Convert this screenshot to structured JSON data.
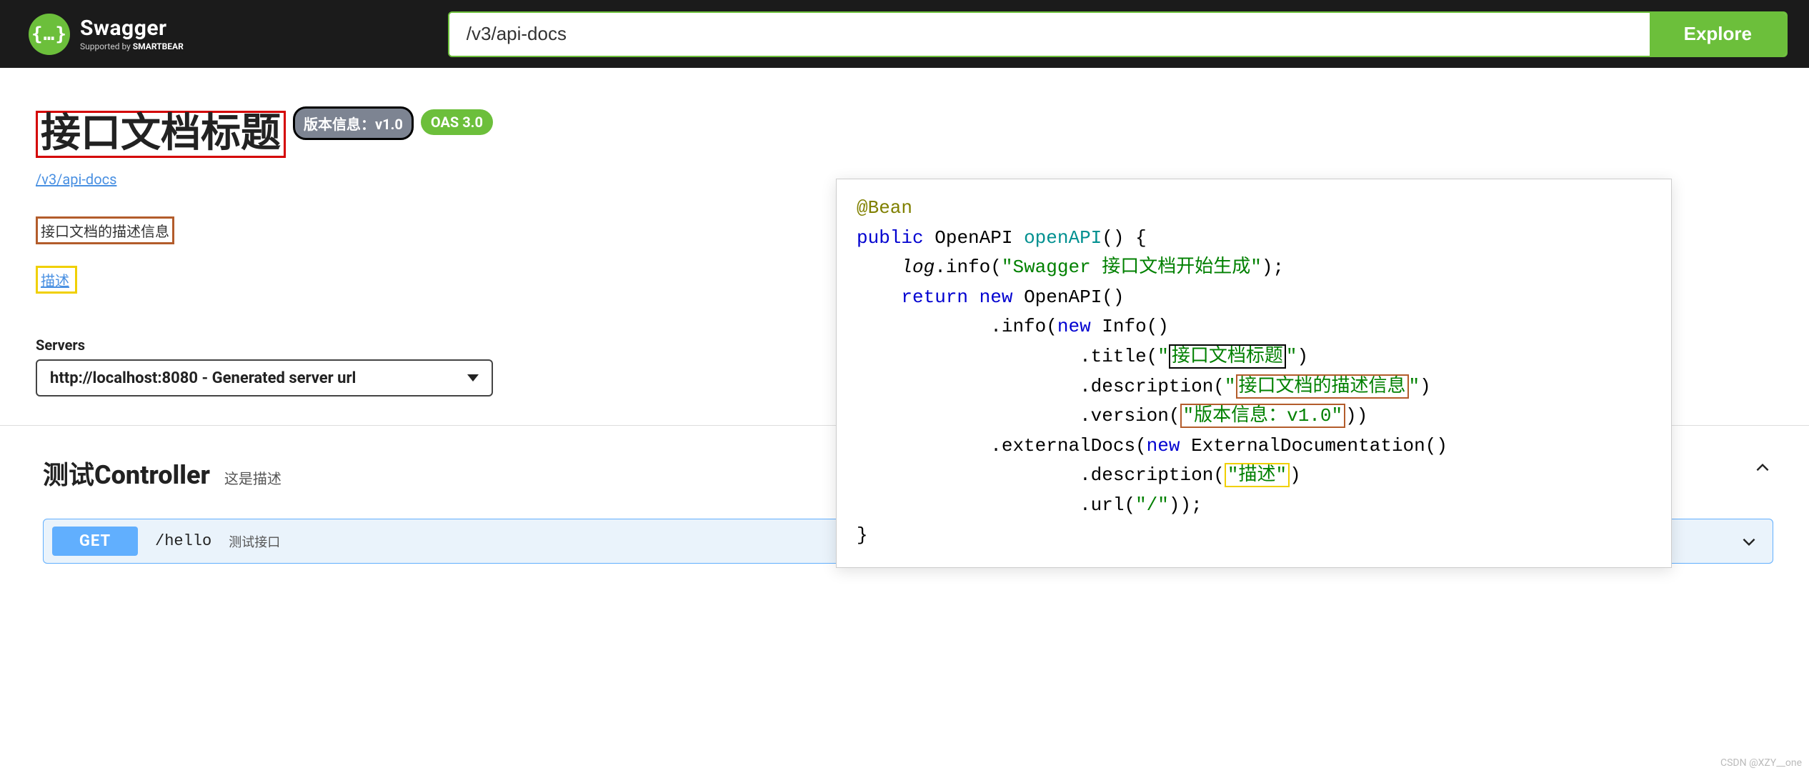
{
  "topbar": {
    "brand": "Swagger",
    "brand_sub_prefix": "Supported by ",
    "brand_sub_bold": "SMARTBEAR",
    "logo_glyph": "{…}",
    "search_value": "/v3/api-docs",
    "explore_label": "Explore"
  },
  "info": {
    "title": "接口文档标题",
    "version_badge": "版本信息：v1.0",
    "oas_badge": "OAS 3.0",
    "api_link": "/v3/api-docs",
    "description": "接口文档的描述信息",
    "external_link": "描述"
  },
  "servers": {
    "label": "Servers",
    "selected": "http://localhost:8080 - Generated server url"
  },
  "tag": {
    "name": "测试Controller",
    "description": "这是描述"
  },
  "operation": {
    "method": "GET",
    "path": "/hello",
    "summary": "测试接口"
  },
  "code": {
    "annotation": "@Bean",
    "kw_public": "public",
    "ret_type": "OpenAPI",
    "fn_name": "openAPI",
    "sig_tail": "() {",
    "log_var": "log",
    "log_call": ".info(",
    "log_str": "\"Swagger 接口文档开始生成\"",
    "log_end": ");",
    "kw_return": "return",
    "kw_new1": "new",
    "ret_ctor": "OpenAPI()",
    "info_call": ".info(",
    "kw_new2": "new",
    "info_ctor": "Info()",
    "title_call": ".title(",
    "title_q1": "\"",
    "title_str": "接口文档标题",
    "title_q2": "\"",
    "title_end": ")",
    "desc_call": ".description(",
    "desc_q1": "\"",
    "desc_str": "接口文档的描述信息",
    "desc_q2": "\"",
    "desc_end": ")",
    "ver_call": ".version(",
    "ver_str": "\"版本信息：v1.0\"",
    "ver_end": "))",
    "ext_call": ".externalDocs(",
    "kw_new3": "new",
    "ext_ctor": "ExternalDocumentation()",
    "ext_desc_call": ".description(",
    "ext_desc_str": "\"描述\"",
    "ext_desc_end": ")",
    "url_call": ".url(",
    "url_str": "\"/\"",
    "url_end": "));",
    "rbrace": "}"
  },
  "watermark": "CSDN @XZY__one"
}
